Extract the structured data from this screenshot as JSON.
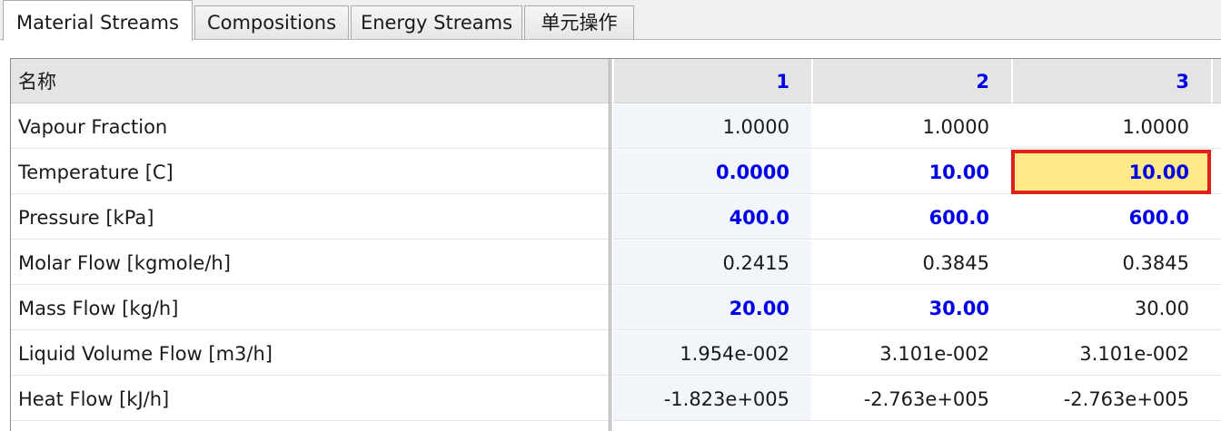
{
  "tabs": [
    "Material Streams",
    "Compositions",
    "Energy Streams",
    "单元操作"
  ],
  "active_tab": "Material Streams",
  "grid": {
    "name_header": "名称",
    "columns": [
      "1",
      "2",
      "3"
    ],
    "rows": [
      {
        "label": "Vapour Fraction",
        "values": [
          "1.0000",
          "1.0000",
          "1.0000"
        ],
        "specified": [
          false,
          false,
          false
        ]
      },
      {
        "label": "Temperature [C]",
        "values": [
          "0.0000",
          "10.00",
          "10.00"
        ],
        "specified": [
          true,
          true,
          true
        ]
      },
      {
        "label": "Pressure [kPa]",
        "values": [
          "400.0",
          "600.0",
          "600.0"
        ],
        "specified": [
          true,
          true,
          true
        ]
      },
      {
        "label": "Molar Flow [kgmole/h]",
        "values": [
          "0.2415",
          "0.3845",
          "0.3845"
        ],
        "specified": [
          false,
          false,
          false
        ]
      },
      {
        "label": "Mass Flow [kg/h]",
        "values": [
          "20.00",
          "30.00",
          "30.00"
        ],
        "specified": [
          true,
          true,
          false
        ]
      },
      {
        "label": "Liquid Volume Flow [m3/h]",
        "values": [
          "1.954e-002",
          "3.101e-002",
          "3.101e-002"
        ],
        "specified": [
          false,
          false,
          false
        ]
      },
      {
        "label": "Heat Flow [kJ/h]",
        "values": [
          "-1.823e+005",
          "-2.763e+005",
          "-2.763e+005"
        ],
        "specified": [
          false,
          false,
          false
        ]
      }
    ],
    "selected_cell": {
      "row": "Temperature [C]",
      "column": "3"
    }
  },
  "colors": {
    "specified_value": "#0000e6",
    "selected_fill": "#fde98a",
    "selected_outline": "#e0201a"
  }
}
